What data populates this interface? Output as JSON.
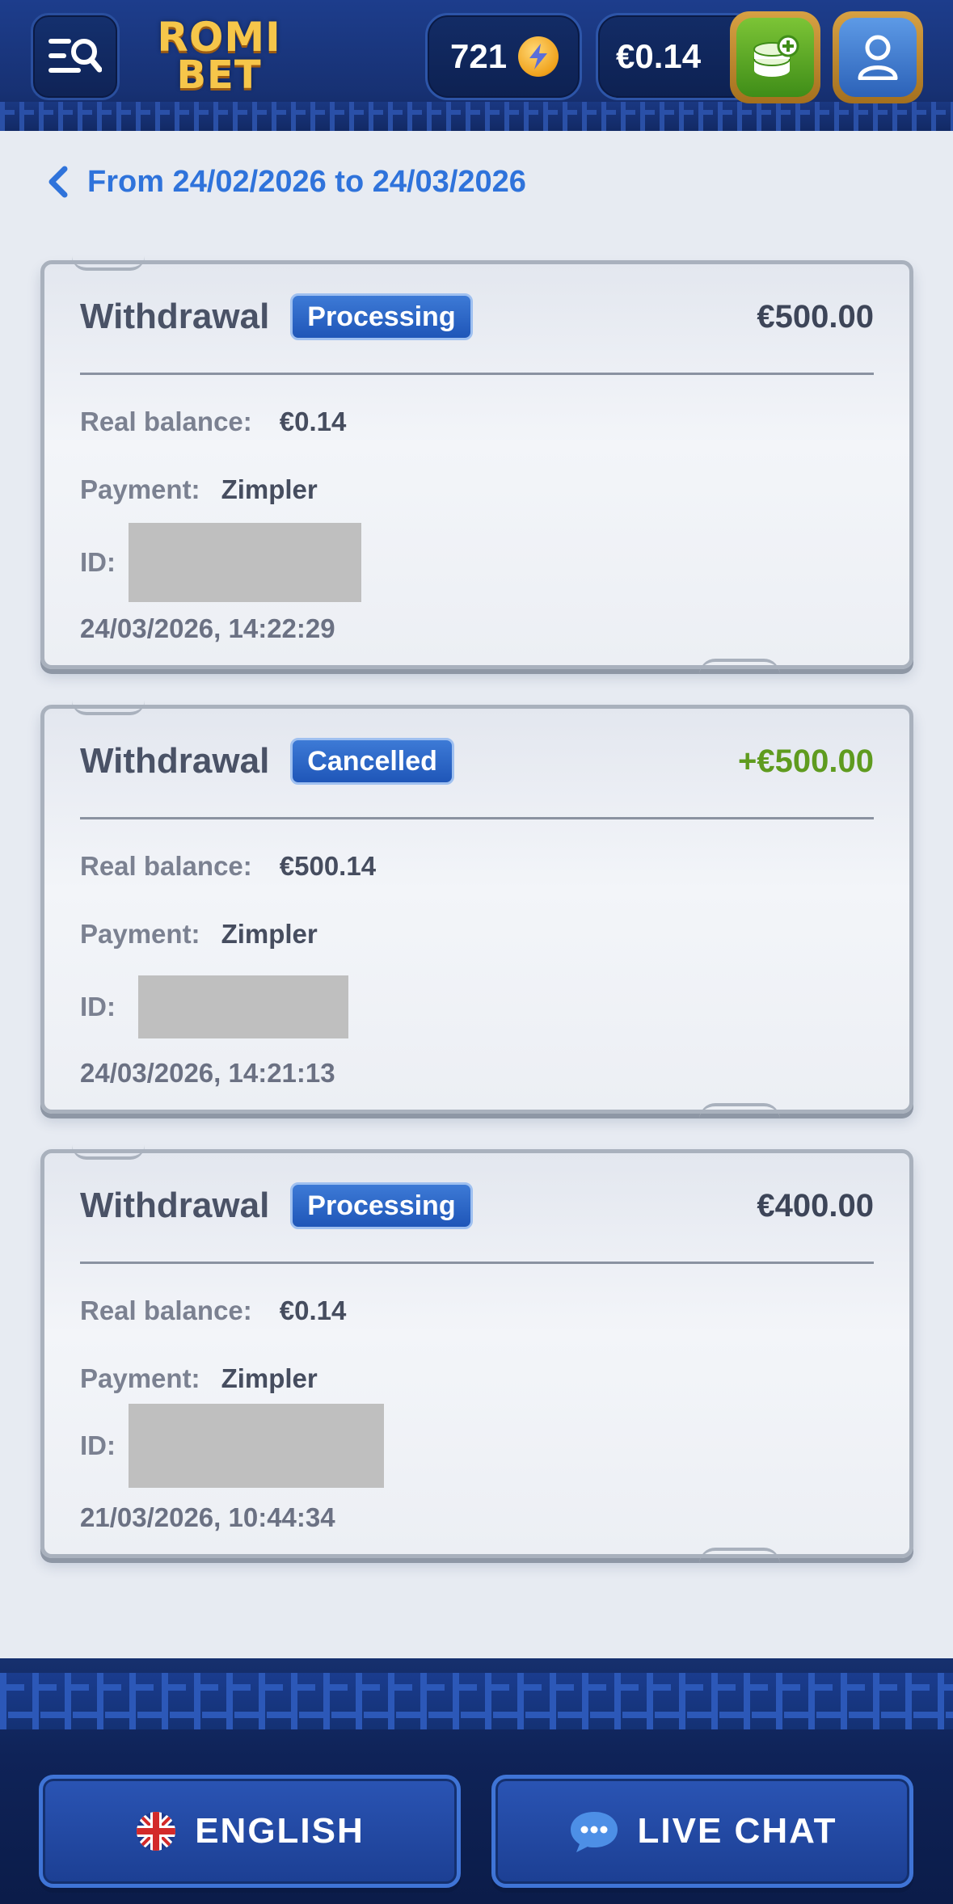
{
  "header": {
    "logo_top": "ROMI",
    "logo_bottom": "BET",
    "coins": "721",
    "balance": "€0.14"
  },
  "date_range": "From 24/02/2026 to 24/03/2026",
  "labels": {
    "real_balance": "Real balance:",
    "payment": "Payment:",
    "id": "ID:"
  },
  "transactions": [
    {
      "type": "Withdrawal",
      "status": "Processing",
      "amount": "€500.00",
      "real_balance": "€0.14",
      "payment": "Zimpler",
      "datetime": "24/03/2026, 14:22:29"
    },
    {
      "type": "Withdrawal",
      "status": "Cancelled",
      "amount": "+€500.00",
      "real_balance": "€500.14",
      "payment": "Zimpler",
      "datetime": "24/03/2026, 14:21:13"
    },
    {
      "type": "Withdrawal",
      "status": "Processing",
      "amount": "€400.00",
      "real_balance": "€0.14",
      "payment": "Zimpler",
      "datetime": "21/03/2026, 10:44:34"
    }
  ],
  "footer": {
    "language_label": "ENGLISH",
    "chat_label": "LIVE CHAT"
  },
  "colors": {
    "accent_blue": "#2f73db",
    "positive_green": "#5f9b1f",
    "badge_blue": "#1f56b8"
  },
  "icons": [
    "menu-search-icon",
    "lightning-coin-icon",
    "deposit-coins-icon",
    "user-icon",
    "chevron-left-icon",
    "uk-flag-icon",
    "chat-bubble-icon"
  ]
}
